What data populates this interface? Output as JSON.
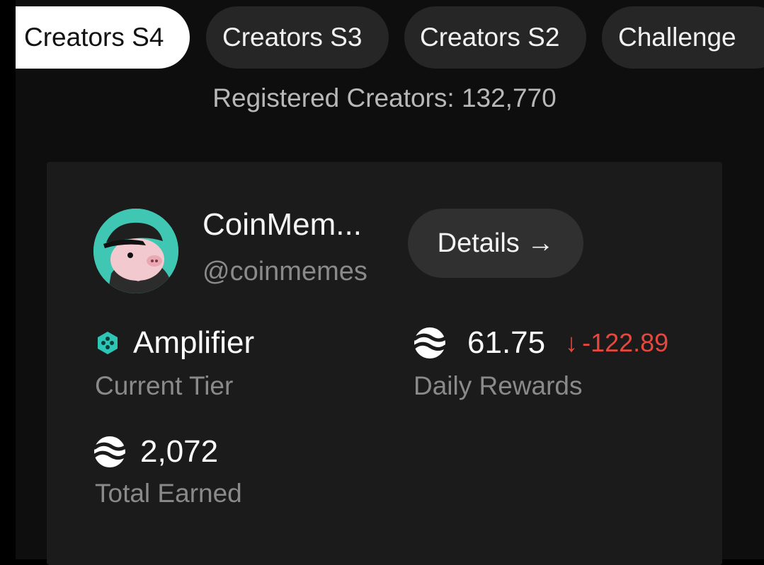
{
  "tabs": [
    {
      "label": "Creators S4",
      "active": true
    },
    {
      "label": "Creators S3",
      "active": false
    },
    {
      "label": "Creators S2",
      "active": false
    },
    {
      "label": "Challenge",
      "active": false
    }
  ],
  "registered_text": "Registered Creators: 132,770",
  "profile": {
    "name": "CoinMem...",
    "handle": "@coinmemes",
    "avatar_icon": "pig-avatar",
    "details_label": "Details →"
  },
  "stats": {
    "tier": {
      "value": "Amplifier",
      "label": "Current Tier",
      "icon": "tier-hexagon-icon"
    },
    "daily": {
      "value": "61.75",
      "change": "-122.89",
      "change_arrow": "↓",
      "label": "Daily Rewards",
      "icon": "token-icon"
    },
    "total": {
      "value": "2,072",
      "label": "Total Earned",
      "icon": "token-icon"
    }
  },
  "colors": {
    "accent_teal": "#2ec4b6",
    "negative": "#e8473d"
  }
}
